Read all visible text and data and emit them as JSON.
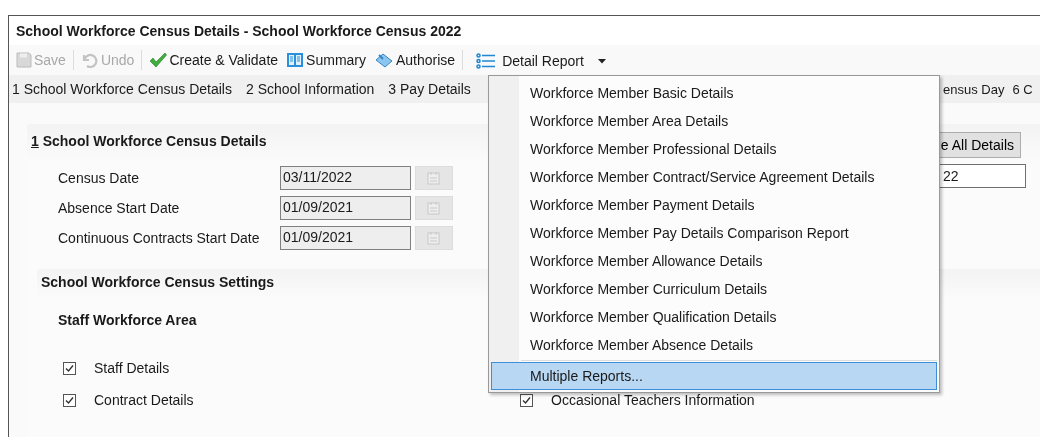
{
  "window": {
    "title": "School Workforce Census Details - School Workforce Census 2022"
  },
  "toolbar": [
    {
      "kind": "save",
      "label": "Save",
      "disabled": true
    },
    {
      "kind": "undo",
      "label": "Undo",
      "disabled": true
    },
    {
      "kind": "validate",
      "label": "Create & Validate",
      "disabled": false
    },
    {
      "kind": "summary",
      "label": "Summary",
      "disabled": false
    },
    {
      "kind": "authorise",
      "label": "Authorise",
      "disabled": false
    }
  ],
  "detail_report": {
    "label": "Detail Report",
    "expanded": true
  },
  "nav_links": [
    "1 School Workforce Census Details",
    "2 School Information",
    "3 Pay Details"
  ],
  "nav_links_right": [
    "ensus Day",
    "6 C"
  ],
  "section": {
    "access_key": "1",
    "title": "School Workforce Census Details",
    "button": "e All Details",
    "field_value": "22"
  },
  "dates": [
    {
      "label": "Census Date",
      "value": "03/11/2022",
      "disabled": true
    },
    {
      "label": "Absence Start Date",
      "value": "01/09/2021",
      "disabled": true
    },
    {
      "label": "Continuous Contracts Start Date",
      "value": "01/09/2021",
      "disabled": true
    }
  ],
  "settings": {
    "title": "School Workforce Census Settings",
    "area_title": "Staff Workforce Area",
    "left": [
      {
        "label": "Staff Details",
        "checked": true
      },
      {
        "label": "Contract Details",
        "checked": true
      }
    ],
    "right": [
      {
        "label": "Occasional Teachers Information",
        "checked": true
      }
    ]
  },
  "menu": {
    "items": [
      {
        "label": "Workforce Member Basic Details",
        "selected": false
      },
      {
        "label": "Workforce Member Area Details",
        "selected": false
      },
      {
        "label": "Workforce Member Professional Details",
        "selected": false
      },
      {
        "label": "Workforce Member Contract/Service Agreement Details",
        "selected": false
      },
      {
        "label": "Workforce Member Payment Details",
        "selected": false
      },
      {
        "label": "Workforce Member Pay Details Comparison Report",
        "selected": false
      },
      {
        "label": "Workforce Member Allowance Details",
        "selected": false
      },
      {
        "label": "Workforce Member Curriculum Details",
        "selected": false
      },
      {
        "label": "Workforce Member Qualification Details",
        "selected": false
      },
      {
        "label": "Workforce Member Absence Details",
        "selected": false
      },
      {
        "label": "Multiple Reports...",
        "selected": true,
        "separated": true
      }
    ]
  }
}
